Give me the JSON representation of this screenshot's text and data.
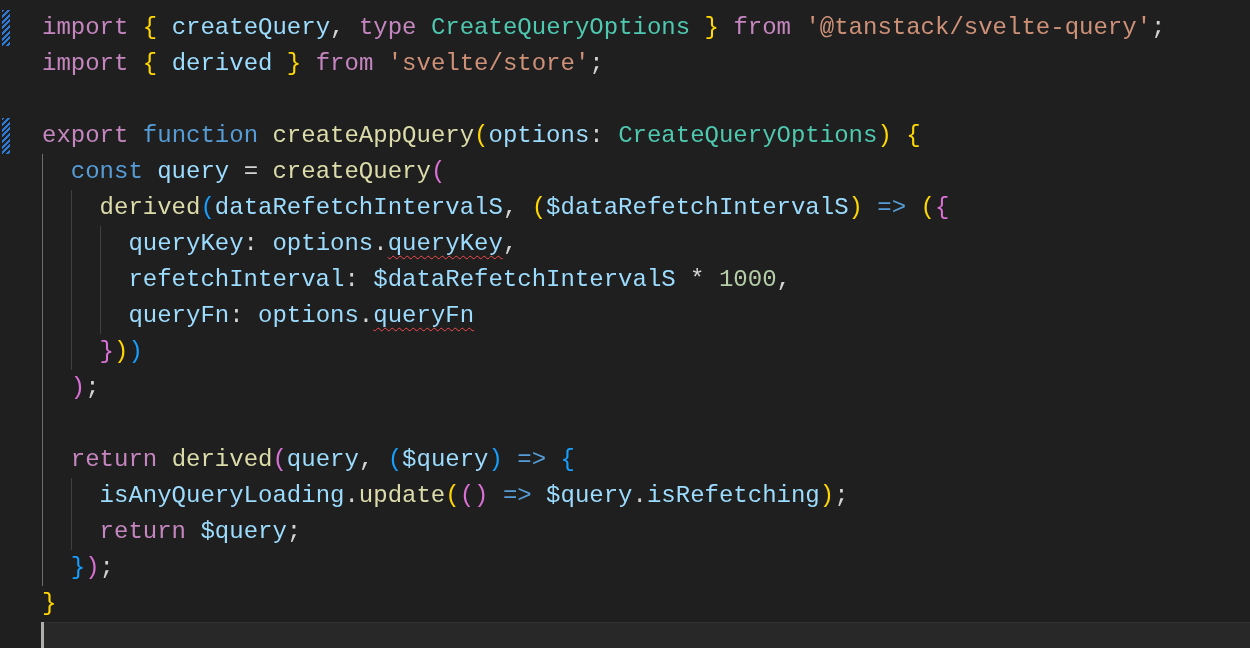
{
  "editor": {
    "lines": [
      {
        "changed": true,
        "current": false,
        "tokens": [
          {
            "kind": "keyword",
            "text": "import "
          },
          {
            "kind": "bracket1",
            "text": "{ "
          },
          {
            "kind": "variable",
            "text": "createQuery"
          },
          {
            "kind": "plain",
            "text": ", "
          },
          {
            "kind": "keyword",
            "text": "type "
          },
          {
            "kind": "type",
            "text": "CreateQueryOptions "
          },
          {
            "kind": "bracket1",
            "text": "} "
          },
          {
            "kind": "keyword",
            "text": "from "
          },
          {
            "kind": "string",
            "text": "'@tanstack/svelte-query'"
          },
          {
            "kind": "plain",
            "text": ";"
          }
        ]
      },
      {
        "changed": false,
        "current": false,
        "tokens": [
          {
            "kind": "keyword",
            "text": "import "
          },
          {
            "kind": "bracket1",
            "text": "{ "
          },
          {
            "kind": "variable",
            "text": "derived "
          },
          {
            "kind": "bracket1",
            "text": "} "
          },
          {
            "kind": "keyword",
            "text": "from "
          },
          {
            "kind": "string",
            "text": "'svelte/store'"
          },
          {
            "kind": "plain",
            "text": ";"
          }
        ]
      },
      {
        "changed": false,
        "current": false
      },
      {
        "changed": true,
        "current": false,
        "tokens": [
          {
            "kind": "keyword",
            "text": "export "
          },
          {
            "kind": "storage",
            "text": "function "
          },
          {
            "kind": "function",
            "text": "createAppQuery"
          },
          {
            "kind": "bracket1",
            "text": "("
          },
          {
            "kind": "variable",
            "text": "options"
          },
          {
            "kind": "plain",
            "text": ": "
          },
          {
            "kind": "type",
            "text": "CreateQueryOptions"
          },
          {
            "kind": "bracket1",
            "text": ") "
          },
          {
            "kind": "bracket1",
            "text": "{"
          }
        ]
      },
      {
        "changed": false,
        "current": false,
        "guides": [
          {
            "active": true
          }
        ],
        "tokens": [
          {
            "kind": "storage",
            "text": "const "
          },
          {
            "kind": "variable",
            "text": "query"
          },
          {
            "kind": "plain",
            "text": " = "
          },
          {
            "kind": "function",
            "text": "createQuery"
          },
          {
            "kind": "bracket2",
            "text": "("
          }
        ]
      },
      {
        "changed": false,
        "current": false,
        "guides": [
          {
            "active": true
          },
          {
            "active": false
          }
        ],
        "tokens": [
          {
            "kind": "function",
            "text": "derived"
          },
          {
            "kind": "bracket3",
            "text": "("
          },
          {
            "kind": "variable",
            "text": "dataRefetchIntervalS"
          },
          {
            "kind": "plain",
            "text": ", "
          },
          {
            "kind": "bracket1",
            "text": "("
          },
          {
            "kind": "variable",
            "text": "$dataRefetchIntervalS"
          },
          {
            "kind": "bracket1",
            "text": ") "
          },
          {
            "kind": "storage",
            "text": "=> "
          },
          {
            "kind": "bracket1",
            "text": "("
          },
          {
            "kind": "bracket2",
            "text": "{"
          }
        ]
      },
      {
        "changed": false,
        "current": false,
        "guides": [
          {
            "active": true
          },
          {
            "active": false
          },
          {
            "active": false
          }
        ],
        "tokens": [
          {
            "kind": "variable",
            "text": "queryKey"
          },
          {
            "kind": "plain",
            "text": ": "
          },
          {
            "kind": "variable",
            "text": "options"
          },
          {
            "kind": "plain",
            "text": "."
          },
          {
            "kind": "flagged",
            "text": "queryKey"
          },
          {
            "kind": "plain",
            "text": ","
          }
        ]
      },
      {
        "changed": false,
        "current": false,
        "guides": [
          {
            "active": true
          },
          {
            "active": false
          },
          {
            "active": false
          }
        ],
        "tokens": [
          {
            "kind": "variable",
            "text": "refetchInterval"
          },
          {
            "kind": "plain",
            "text": ": "
          },
          {
            "kind": "variable",
            "text": "$dataRefetchIntervalS"
          },
          {
            "kind": "plain",
            "text": " * "
          },
          {
            "kind": "number",
            "text": "1000"
          },
          {
            "kind": "plain",
            "text": ","
          }
        ]
      },
      {
        "changed": false,
        "current": false,
        "guides": [
          {
            "active": true
          },
          {
            "active": false
          },
          {
            "active": false
          }
        ],
        "tokens": [
          {
            "kind": "variable",
            "text": "queryFn"
          },
          {
            "kind": "plain",
            "text": ": "
          },
          {
            "kind": "variable",
            "text": "options"
          },
          {
            "kind": "plain",
            "text": "."
          },
          {
            "kind": "flagged",
            "text": "queryFn"
          }
        ]
      },
      {
        "changed": false,
        "current": false,
        "guides": [
          {
            "active": true
          },
          {
            "active": false
          }
        ],
        "tokens": [
          {
            "kind": "bracket2",
            "text": "}"
          },
          {
            "kind": "bracket1",
            "text": ")"
          },
          {
            "kind": "bracket3",
            "text": ")"
          }
        ]
      },
      {
        "changed": false,
        "current": false,
        "guides": [
          {
            "active": true
          }
        ],
        "tokens": [
          {
            "kind": "bracket2",
            "text": ")"
          },
          {
            "kind": "plain",
            "text": ";"
          }
        ]
      },
      {
        "changed": false,
        "current": false,
        "guides": [
          {
            "active": true
          }
        ]
      },
      {
        "changed": false,
        "current": false,
        "guides": [
          {
            "active": true
          }
        ],
        "tokens": [
          {
            "kind": "keyword",
            "text": "return "
          },
          {
            "kind": "function",
            "text": "derived"
          },
          {
            "kind": "bracket2",
            "text": "("
          },
          {
            "kind": "variable",
            "text": "query"
          },
          {
            "kind": "plain",
            "text": ", "
          },
          {
            "kind": "bracket3",
            "text": "("
          },
          {
            "kind": "variable",
            "text": "$query"
          },
          {
            "kind": "bracket3",
            "text": ") "
          },
          {
            "kind": "storage",
            "text": "=> "
          },
          {
            "kind": "bracket3",
            "text": "{"
          }
        ]
      },
      {
        "changed": false,
        "current": false,
        "guides": [
          {
            "active": true
          },
          {
            "active": false
          }
        ],
        "tokens": [
          {
            "kind": "variable",
            "text": "isAnyQueryLoading"
          },
          {
            "kind": "plain",
            "text": "."
          },
          {
            "kind": "function",
            "text": "update"
          },
          {
            "kind": "bracket1",
            "text": "("
          },
          {
            "kind": "bracket2",
            "text": "() "
          },
          {
            "kind": "storage",
            "text": "=> "
          },
          {
            "kind": "variable",
            "text": "$query"
          },
          {
            "kind": "plain",
            "text": "."
          },
          {
            "kind": "variable",
            "text": "isRefetching"
          },
          {
            "kind": "bracket1",
            "text": ")"
          },
          {
            "kind": "plain",
            "text": ";"
          }
        ]
      },
      {
        "changed": false,
        "current": false,
        "guides": [
          {
            "active": true
          },
          {
            "active": false
          }
        ],
        "tokens": [
          {
            "kind": "keyword",
            "text": "return "
          },
          {
            "kind": "variable",
            "text": "$query"
          },
          {
            "kind": "plain",
            "text": ";"
          }
        ]
      },
      {
        "changed": false,
        "current": false,
        "guides": [
          {
            "active": true
          }
        ],
        "tokens": [
          {
            "kind": "bracket3",
            "text": "}"
          },
          {
            "kind": "bracket2",
            "text": ")"
          },
          {
            "kind": "plain",
            "text": ";"
          }
        ]
      },
      {
        "changed": false,
        "current": false,
        "tokens": [
          {
            "kind": "bracket1",
            "text": "}"
          }
        ]
      },
      {
        "changed": false,
        "current": true
      }
    ]
  }
}
